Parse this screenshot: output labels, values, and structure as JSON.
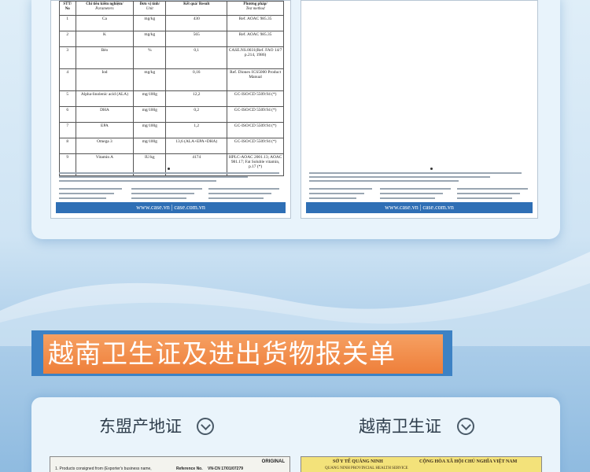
{
  "test_report": {
    "headers": {
      "stt": "STT/ No",
      "param": "Chỉ tiêu kiểm nghiệm/",
      "param_en": "Parameters",
      "unit": "Đơn vị tính/",
      "unit_en": "Unit",
      "result": "Kết quả/ Result",
      "method": "Phương pháp/",
      "method_en": "Test method"
    },
    "rows": [
      {
        "stt": "1",
        "param": "Ca",
        "unit": "mg/kg",
        "result": "430",
        "method": "Ref. AOAC 985.35"
      },
      {
        "stt": "2",
        "param": "K",
        "unit": "mg/kg",
        "result": "565",
        "method": "Ref. AOAC 985.35"
      },
      {
        "stt": "3",
        "param": "Béo",
        "unit": "%",
        "result": "0,1",
        "method": "CASE.NS.0031(Ref. FAO 14/7 p.214, 1986)"
      },
      {
        "stt": "4",
        "param": "Iod",
        "unit": "mg/kg",
        "result": "0,16",
        "method": "Ref. Dionex ICS5000 Product Manual"
      },
      {
        "stt": "5",
        "param": "Alpha-linolenic acid (ALA)",
        "unit": "mg/100g",
        "result": "12,2",
        "method": "GC-ISO/CD 5509:94 (*)"
      },
      {
        "stt": "6",
        "param": "DHA",
        "unit": "mg/100g",
        "result": "0,2",
        "method": "GC-ISO/CD 5509:94 (*)"
      },
      {
        "stt": "7",
        "param": "EPA",
        "unit": "mg/100g",
        "result": "1,2",
        "method": "GC-ISO/CD 5509:94 (*)"
      },
      {
        "stt": "8",
        "param": "Omega 3",
        "unit": "mg/100g",
        "result": "13,6 (ALA+EPA+DHA)",
        "method": "GC-ISO/CD 5509:94 (*)"
      },
      {
        "stt": "9",
        "param": "Vitamin A",
        "unit": "IU/kg",
        "result": "4174",
        "method": "HPLC-AOAC 2001.13; AOAC 981.17; Fat Soluble vitamin, p.17 (*)"
      }
    ],
    "website": "www.case.vn | case.com.vn"
  },
  "section_heading": "越南卫生证及进出货物报关单",
  "certificates": {
    "left_label": "东盟产地证",
    "right_label": "越南卫生证",
    "left_doc_line": "1. Products consigned from (Exporter's business name,",
    "left_doc_ref": "Reference No.",
    "left_doc_ref_value": "VN-CN 17/01/07279",
    "left_doc_original": "ORIGINAL",
    "right_doc_line1": "SỞ Y TẾ QUẢNG NINH",
    "right_doc_line2": "CỘNG HÒA XÃ HỘI CHỦ NGHĨA VIỆT NAM",
    "right_doc_line3": "QUANG NINH PROVINCIAL HEALTH SERVICE"
  },
  "colors": {
    "banner_orange": "#ee7f3a",
    "banner_blue": "#3d82c4",
    "doc_strip_blue": "#2f6fb5"
  }
}
